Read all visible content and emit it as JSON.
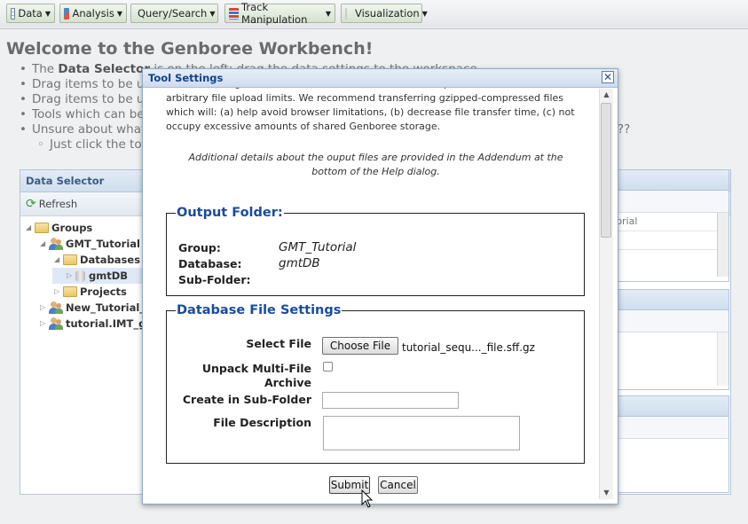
{
  "menubar": {
    "items": [
      {
        "label": "Data",
        "icon": "table-icon"
      },
      {
        "label": "Analysis",
        "icon": "analysis-icon"
      },
      {
        "label": "Query/Search",
        "icon": "binoculars-icon"
      },
      {
        "label": "Track Manipulation",
        "icon": "tracks-icon"
      },
      {
        "label": "Visualization",
        "icon": "visualization-icon"
      }
    ]
  },
  "welcome": {
    "title": "Welcome to the Genboree Workbench!",
    "item1_prefix": "The ",
    "item1_bold": "Data Selector",
    "item1_rest": " is on the left; drag the data settings to the workspace.",
    "item2": "Drag items to be used as inputs into Inputs.",
    "item3": "Drag items to be used as outputs into Outputs.",
    "item4": "Tools which can be run are shown in the menu.",
    "item5": "Unsure about what tool to use? Check the help for guidance.",
    "sub1": "Just click the tool in the menu.",
    "tail": "??"
  },
  "data_selector": {
    "title": "Data Selector",
    "refresh_label": "Refresh",
    "tree": [
      {
        "label": "Groups",
        "kind": "groups"
      },
      {
        "label": "GMT_Tutorial",
        "kind": "group"
      },
      {
        "label": "Databases",
        "kind": "folder"
      },
      {
        "label": "gmtDB",
        "kind": "db"
      },
      {
        "label": "Projects",
        "kind": "folder"
      },
      {
        "label": "New_Tutorial_Group",
        "kind": "group"
      },
      {
        "label": "tutorial.IMT_group",
        "kind": "group"
      }
    ],
    "right_cell": "torial"
  },
  "modal": {
    "title": "Tool Settings",
    "close_label": "✕",
    "para_top": "FSU due to bugs in the browser's code. We have found Opera not to have such arbitrary file upload limits. We recommend transferring gzipped-compressed files which will: (a) help avoid browser limitations, (b) decrease file transfer time, (c) not occupy excessive amounts of shared Genboree storage.",
    "para_italic": "Additional details about the ouput files are provided in the Addendum at the bottom of the Help dialog.",
    "output_folder": {
      "legend": "Output Folder:",
      "group_label": "Group:",
      "group_value": "GMT_Tutorial",
      "database_label": "Database:",
      "database_value": "gmtDB",
      "subfolder_label": "Sub-Folder:"
    },
    "db_file_settings": {
      "legend": "Database File Settings",
      "select_file_label": "Select File",
      "choose_file_button": "Choose File",
      "chosen_file": "tutorial_sequ..._file.sff.gz",
      "unpack_label_1": "Unpack Multi-File",
      "unpack_label_2": "Archive",
      "create_subfolder_label": "Create in Sub-Folder",
      "subfolder_value": "",
      "file_description_label": "File Description",
      "file_description_value": ""
    },
    "submit_label": "Submit",
    "cancel_label": "Cancel"
  }
}
